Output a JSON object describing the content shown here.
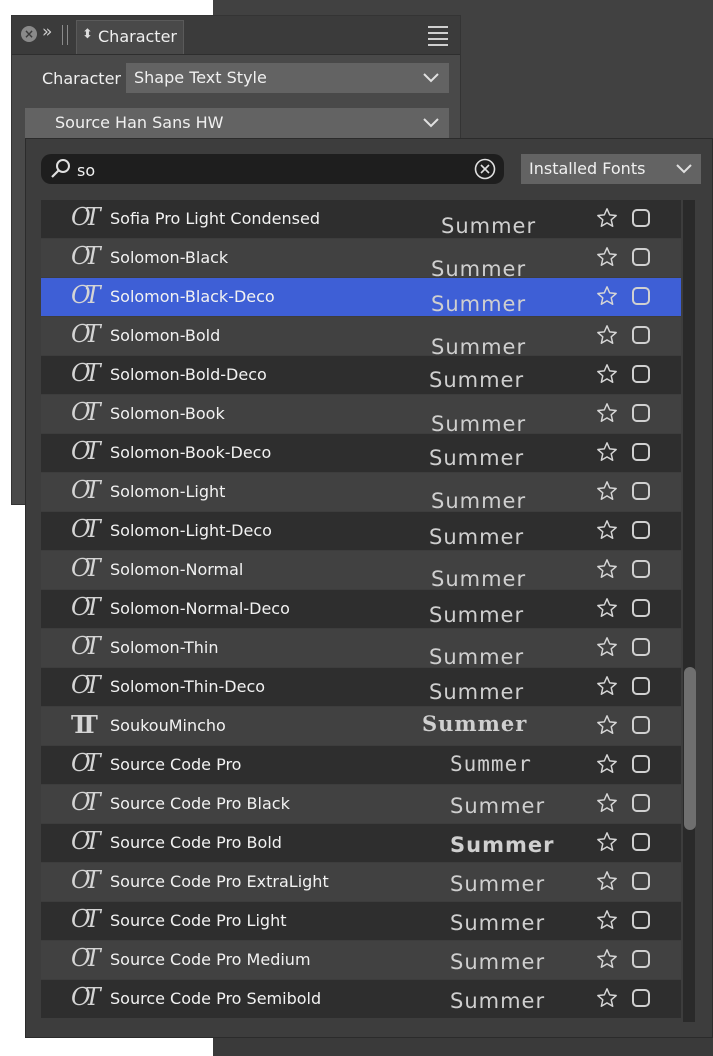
{
  "panel": {
    "tab_title": "Character",
    "character_label": "Character",
    "style_value": "Shape Text Style",
    "font_value": "Source Han Sans HW"
  },
  "popup": {
    "search_value": "so",
    "filter_value": "Installed Fonts",
    "preview_text": "Summer",
    "selected_index": 2,
    "scroll_position": 0.64,
    "fonts": [
      {
        "name": "Sofia Pro Light Condensed",
        "icon": "opentype-icon"
      },
      {
        "name": "Solomon-Black",
        "icon": "opentype-icon"
      },
      {
        "name": "Solomon-Black-Deco",
        "icon": "opentype-icon"
      },
      {
        "name": "Solomon-Bold",
        "icon": "opentype-icon"
      },
      {
        "name": "Solomon-Bold-Deco",
        "icon": "opentype-icon"
      },
      {
        "name": "Solomon-Book",
        "icon": "opentype-icon"
      },
      {
        "name": "Solomon-Book-Deco",
        "icon": "opentype-icon"
      },
      {
        "name": "Solomon-Light",
        "icon": "opentype-icon"
      },
      {
        "name": "Solomon-Light-Deco",
        "icon": "opentype-icon"
      },
      {
        "name": "Solomon-Normal",
        "icon": "opentype-icon"
      },
      {
        "name": "Solomon-Normal-Deco",
        "icon": "opentype-icon"
      },
      {
        "name": "Solomon-Thin",
        "icon": "opentype-icon"
      },
      {
        "name": "Solomon-Thin-Deco",
        "icon": "opentype-icon"
      },
      {
        "name": "SoukouMincho",
        "icon": "truetype-icon"
      },
      {
        "name": "Source Code Pro",
        "icon": "opentype-icon"
      },
      {
        "name": "Source Code Pro Black",
        "icon": "opentype-icon"
      },
      {
        "name": "Source Code Pro Bold",
        "icon": "opentype-icon"
      },
      {
        "name": "Source Code Pro ExtraLight",
        "icon": "opentype-icon"
      },
      {
        "name": "Source Code Pro Light",
        "icon": "opentype-icon"
      },
      {
        "name": "Source Code Pro Medium",
        "icon": "opentype-icon"
      },
      {
        "name": "Source Code Pro Semibold",
        "icon": "opentype-icon"
      }
    ]
  },
  "colors": {
    "selection": "#3e5fd6",
    "row_dark": "#2e2e2e",
    "row_light": "#414141"
  }
}
